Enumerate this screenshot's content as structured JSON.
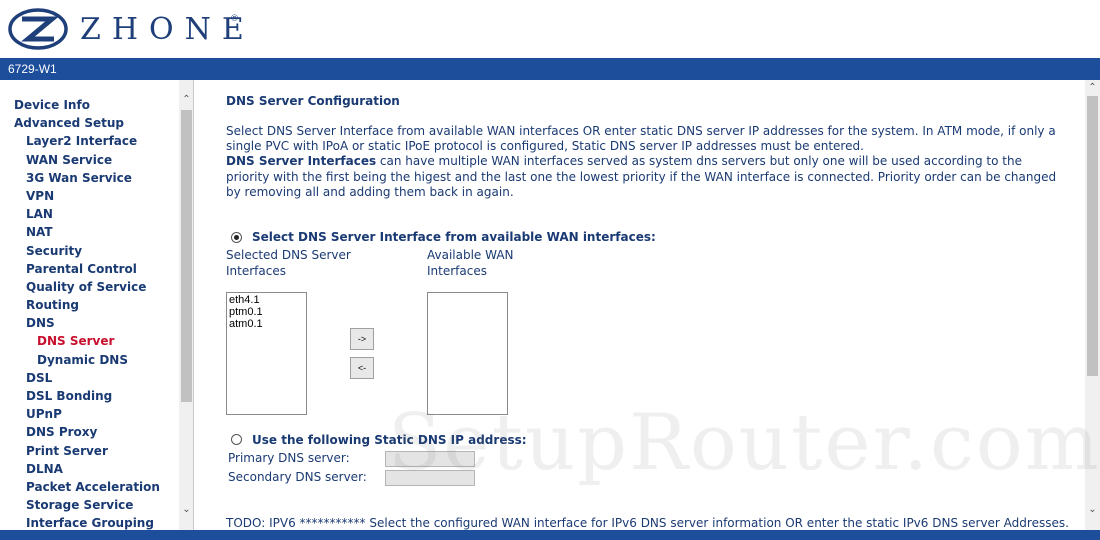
{
  "header": {
    "brand": "ZHONE",
    "tm": "®",
    "model": "6729-W1"
  },
  "nav": {
    "items": [
      {
        "label": "Device Info",
        "level": 0
      },
      {
        "label": "Advanced Setup",
        "level": 0
      },
      {
        "label": "Layer2 Interface",
        "level": 1
      },
      {
        "label": "WAN Service",
        "level": 1
      },
      {
        "label": "3G Wan Service",
        "level": 1
      },
      {
        "label": "VPN",
        "level": 1
      },
      {
        "label": "LAN",
        "level": 1
      },
      {
        "label": "NAT",
        "level": 1
      },
      {
        "label": "Security",
        "level": 1
      },
      {
        "label": "Parental Control",
        "level": 1
      },
      {
        "label": "Quality of Service",
        "level": 1
      },
      {
        "label": "Routing",
        "level": 1
      },
      {
        "label": "DNS",
        "level": 1
      },
      {
        "label": "DNS Server",
        "level": 2,
        "active": true
      },
      {
        "label": "Dynamic DNS",
        "level": 2
      },
      {
        "label": "DSL",
        "level": 1
      },
      {
        "label": "DSL Bonding",
        "level": 1
      },
      {
        "label": "UPnP",
        "level": 1
      },
      {
        "label": "DNS Proxy",
        "level": 1
      },
      {
        "label": "Print Server",
        "level": 1
      },
      {
        "label": "DLNA",
        "level": 1
      },
      {
        "label": "Packet Acceleration",
        "level": 1
      },
      {
        "label": "Storage Service",
        "level": 1
      },
      {
        "label": "Interface Grouping",
        "level": 1
      }
    ]
  },
  "main": {
    "title": "DNS Server Configuration",
    "desc_line1": "Select DNS Server Interface from available WAN interfaces OR enter static DNS server IP addresses for the system. In ATM mode, if only a single PVC with IPoA or static IPoE protocol is configured, Static DNS server IP addresses must be entered.",
    "desc_bold": "DNS Server Interfaces",
    "desc_line2": " can have multiple WAN interfaces served as system dns servers but only one will be used according to the priority with the first being the higest and the last one the lowest priority if the WAN interface is connected. Priority order can be changed by removing all and adding them back in again.",
    "radio_wan_label": "Select DNS Server Interface from available WAN interfaces:",
    "selected_label": "Selected DNS Server Interfaces",
    "available_label": "Available WAN Interfaces",
    "selected_interfaces": [
      "eth4.1",
      "ptm0.1",
      "atm0.1"
    ],
    "available_interfaces": [],
    "add_button": "->",
    "remove_button": "<-",
    "radio_static_label": "Use the following Static DNS IP address:",
    "primary_label": "Primary DNS server:",
    "secondary_label": "Secondary DNS server:",
    "primary_value": "",
    "secondary_value": "",
    "todo": "TODO: IPV6 *********** Select the configured WAN interface for IPv6 DNS server information OR enter the static IPv6 DNS server Addresses.",
    "dns_mode": "wan"
  },
  "watermark": "SetupRouter.com",
  "colors": {
    "brand_blue": "#1c4e9c",
    "nav_text": "#1a3a73",
    "nav_active": "#c8102e"
  }
}
